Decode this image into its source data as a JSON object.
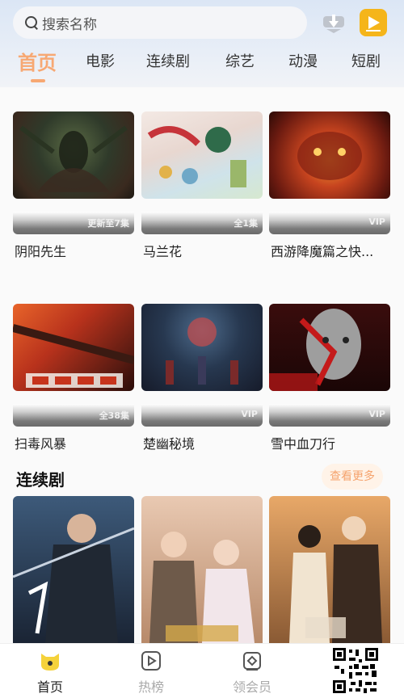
{
  "search": {
    "placeholder": "搜索名称"
  },
  "tabs": [
    {
      "label": "首页"
    },
    {
      "label": "电影"
    },
    {
      "label": "连续剧"
    },
    {
      "label": "综艺"
    },
    {
      "label": "动漫"
    },
    {
      "label": "短剧"
    }
  ],
  "row1": [
    {
      "title": "阴阳先生",
      "badge": "更新至7集"
    },
    {
      "title": "马兰花",
      "badge": "全1集"
    },
    {
      "title": "西游降魔篇之快...",
      "badge": "VIP"
    }
  ],
  "row2": [
    {
      "title": "扫毒风暴",
      "badge": "全38集"
    },
    {
      "title": "楚幽秘境",
      "badge": "VIP"
    },
    {
      "title": "雪中血刀行",
      "badge": "VIP"
    }
  ],
  "section": {
    "title": "连续剧",
    "more_label": "查看更多"
  },
  "nav": [
    {
      "label": "首页"
    },
    {
      "label": "热榜"
    },
    {
      "label": "领会员"
    }
  ],
  "colors": {
    "accent": "#f7a873",
    "active_tab": "#f7a873",
    "nav_active": "#f5d23a"
  }
}
